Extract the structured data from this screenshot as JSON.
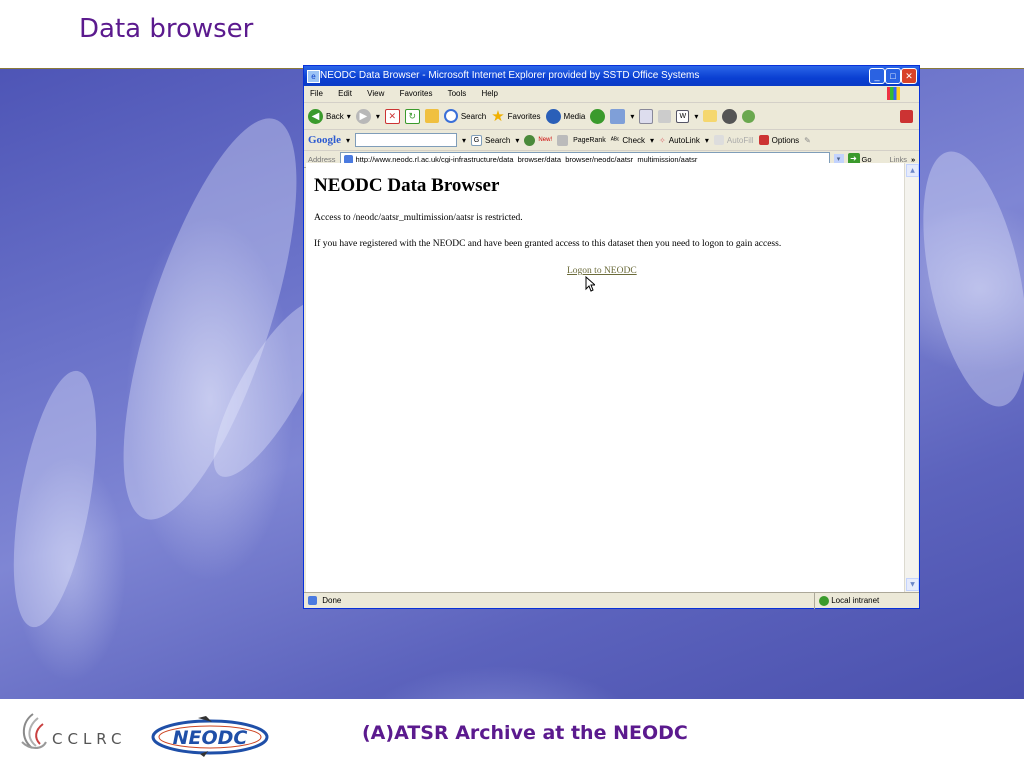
{
  "slide": {
    "title": "Data browser",
    "footer_title": "(A)ATSR Archive at the NEODC",
    "logos": {
      "cclrc": "CCLRC",
      "neodc": "NEODC"
    }
  },
  "browser": {
    "window_title": "NEODC Data Browser - Microsoft Internet Explorer provided by SSTD Office Systems",
    "menu": [
      "File",
      "Edit",
      "View",
      "Favorites",
      "Tools",
      "Help"
    ],
    "toolbar": {
      "back": "Back",
      "search": "Search",
      "favorites": "Favorites",
      "media": "Media"
    },
    "google_bar": {
      "logo": "Google",
      "search_label": "Search",
      "new_badge": "New!",
      "pagerank": "PageRank",
      "check": "Check",
      "autolink": "AutoLink",
      "autofill": "AutoFill",
      "options": "Options"
    },
    "address": {
      "label": "Address",
      "url": "http://www.neodc.rl.ac.uk/cgi-infrastructure/data_browser/data_browser/neodc/aatsr_multimission/aatsr",
      "go": "Go",
      "links": "Links"
    },
    "page": {
      "heading": "NEODC Data Browser",
      "restricted_text": "Access to /neodc/aatsr_multimission/aatsr is restricted.",
      "info_text": "If you have registered with the NEODC and have been granted access to this dataset then you need to logon to gain access.",
      "logon_link": "Logon to NEODC"
    },
    "status": {
      "left": "Done",
      "zone": "Local intranet"
    }
  }
}
